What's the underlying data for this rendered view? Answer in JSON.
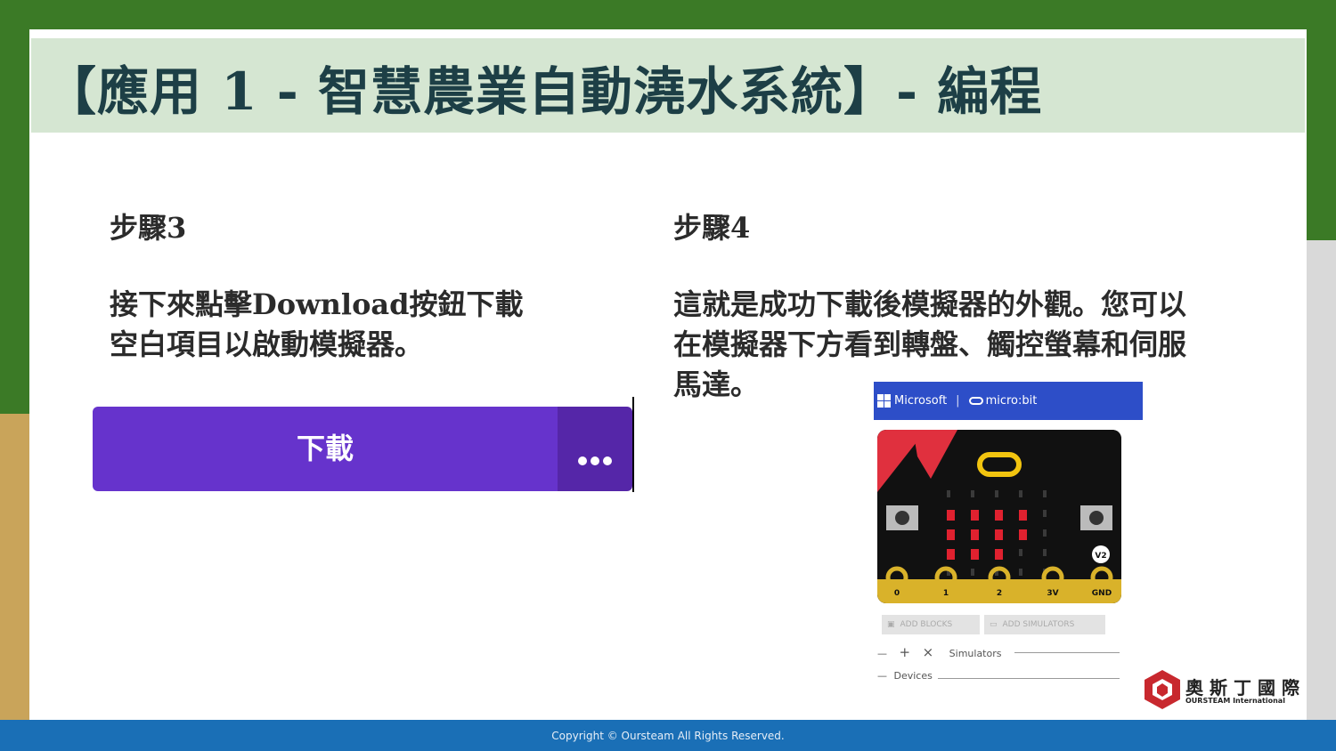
{
  "slide": {
    "title": "【應用 1 - 智慧農業自動澆水系統】- 編程"
  },
  "step3": {
    "heading": "步驟3",
    "line1": "接下來點擊Download按鈕下載",
    "line2": "空白項目以啟動模擬器。",
    "download_label": "下載",
    "more_label": "•••"
  },
  "step4": {
    "heading": "步驟4",
    "line1": "這就是成功下載後模擬器的外觀。您可以",
    "line2": "在模擬器下方看到轉盤、觸控螢幕和伺服",
    "line3": "馬達。"
  },
  "simulator": {
    "brand": "Microsoft",
    "product": "micro:bit",
    "badge": "V2",
    "pins": [
      "0",
      "1",
      "2",
      "3V",
      "GND"
    ],
    "add_blocks": "ADD BLOCKS",
    "add_simulators": "ADD SIMULATORS",
    "simulators_label": "Simulators",
    "devices_label": "Devices"
  },
  "logo": {
    "name": "奧斯丁國際",
    "sub": "OURSTEAM International"
  },
  "footer": {
    "copyright": "Copyright © Oursteam All Rights Reserved."
  },
  "colors": {
    "title_bg": "#d5e6d2",
    "title_text": "#1d3f46",
    "download_button": "#6633cc",
    "simulator_header": "#2d4ec8",
    "footer_bg": "#1a6fb6",
    "led_on": "#e0212f"
  }
}
